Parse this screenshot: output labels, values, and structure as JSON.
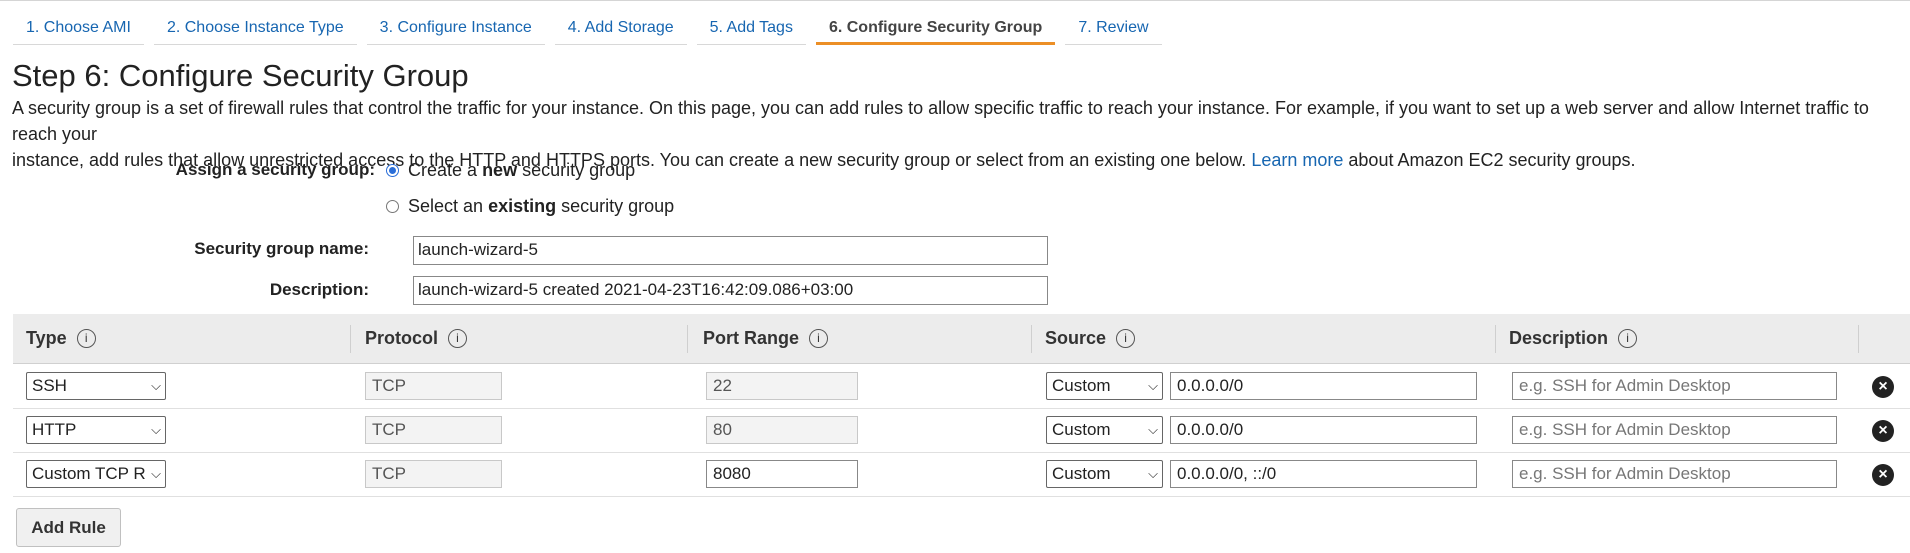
{
  "wizard": {
    "steps": [
      "1. Choose AMI",
      "2. Choose Instance Type",
      "3. Configure Instance",
      "4. Add Storage",
      "5. Add Tags",
      "6. Configure Security Group",
      "7. Review"
    ],
    "active_step": 5
  },
  "page": {
    "title": "Step 6: Configure Security Group",
    "description_line1": "A security group is a set of firewall rules that control the traffic for your instance. On this page, you can add rules to allow specific traffic to reach your instance. For example, if you want to set up a web server and allow Internet traffic to reach your",
    "description_line2_before": "instance, add rules that allow unrestricted access to the HTTP and HTTPS ports. You can create a new security group or select from an existing one below.",
    "learn_more": "Learn more",
    "description_line2_after": "about Amazon EC2 security groups."
  },
  "assign": {
    "label": "Assign a security group:",
    "option_new": {
      "pre": "Create a",
      "bold": "new",
      "post": "security group",
      "checked": true
    },
    "option_existing": {
      "pre": "Select an",
      "bold": "existing",
      "post": "security group",
      "checked": false
    }
  },
  "form": {
    "name_label": "Security group name:",
    "name_value": "launch-wizard-5",
    "desc_label": "Description:",
    "desc_value": "launch-wizard-5 created 2021-04-23T16:42:09.086+03:00"
  },
  "table": {
    "headers": {
      "type": "Type",
      "protocol": "Protocol",
      "port_range": "Port Range",
      "source": "Source",
      "description": "Description"
    },
    "info_glyph": "i",
    "rows": [
      {
        "type": "SSH",
        "protocol": "TCP",
        "port": "22",
        "port_editable": false,
        "source_mode": "Custom",
        "source": "0.0.0.0/0",
        "desc_placeholder": "e.g. SSH for Admin Desktop"
      },
      {
        "type": "HTTP",
        "protocol": "TCP",
        "port": "80",
        "port_editable": false,
        "source_mode": "Custom",
        "source": "0.0.0.0/0",
        "desc_placeholder": "e.g. SSH for Admin Desktop"
      },
      {
        "type": "Custom TCP R",
        "protocol": "TCP",
        "port": "8080",
        "port_editable": true,
        "source_mode": "Custom",
        "source": "0.0.0.0/0, ::/0",
        "desc_placeholder": "e.g. SSH for Admin Desktop"
      }
    ]
  },
  "add_rule_label": "Add Rule",
  "colors": {
    "link": "#1766b1",
    "active_tab_underline": "#ec8f26",
    "header_bg": "#ececec"
  },
  "icons": {
    "info": "info-icon",
    "remove": "remove-rule-icon",
    "dropdown": "chevron-down-icon"
  }
}
